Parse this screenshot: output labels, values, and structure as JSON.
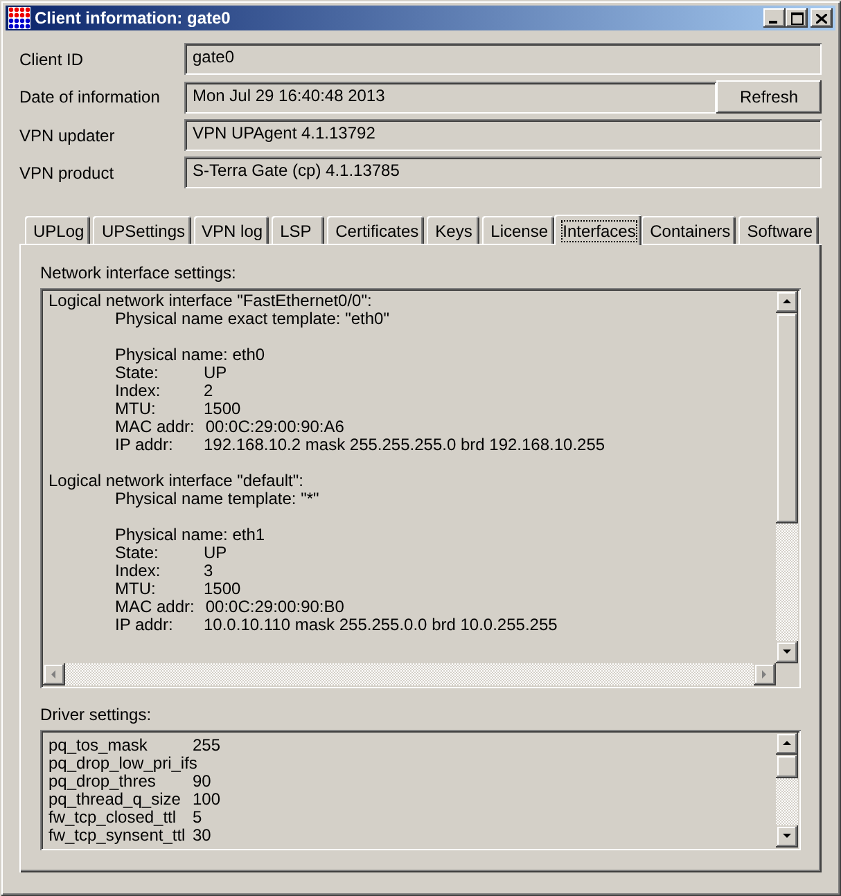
{
  "window": {
    "title": "Client information: gate0"
  },
  "info": [
    {
      "label": "Client ID",
      "value": "gate0"
    },
    {
      "label": "Date of information",
      "value": "Mon Jul 29 16:40:48 2013",
      "button": "Refresh"
    },
    {
      "label": "VPN updater",
      "value": "VPN UPAgent 4.1.13792"
    },
    {
      "label": "VPN product",
      "value": "S-Terra Gate (cp) 4.1.13785"
    }
  ],
  "tabs": [
    {
      "label": "UPLog",
      "selected": false
    },
    {
      "label": "UPSettings",
      "selected": false
    },
    {
      "label": "VPN log",
      "selected": false
    },
    {
      "label": "LSP",
      "selected": false
    },
    {
      "label": "Certificates",
      "selected": false
    },
    {
      "label": "Keys",
      "selected": false
    },
    {
      "label": "License",
      "selected": false
    },
    {
      "label": "Interfaces",
      "selected": true
    },
    {
      "label": "Containers",
      "selected": false
    },
    {
      "label": "Software",
      "selected": false
    }
  ],
  "network_settings": {
    "label": "Network interface settings:",
    "interfaces": [
      {
        "title": "Logical network interface \"FastEthernet0/0\":",
        "template": "Physical name exact template: \"eth0\"",
        "physical_name": "Physical name: eth0",
        "fields": [
          {
            "key": "State:",
            "value": "UP"
          },
          {
            "key": "Index:",
            "value": "2"
          },
          {
            "key": "MTU:",
            "value": "1500"
          },
          {
            "key": "MAC addr:",
            "value": "00:0C:29:00:90:A6"
          },
          {
            "key": "IP addr:",
            "value": "192.168.10.2 mask 255.255.255.0 brd 192.168.10.255"
          }
        ]
      },
      {
        "title": "Logical network interface \"default\":",
        "template": "Physical name template: \"*\"",
        "physical_name": "Physical name: eth1",
        "fields": [
          {
            "key": "State:",
            "value": "UP"
          },
          {
            "key": "Index:",
            "value": "3"
          },
          {
            "key": "MTU:",
            "value": "1500"
          },
          {
            "key": "MAC addr:",
            "value": "00:0C:29:00:90:B0"
          },
          {
            "key": "IP addr:",
            "value": "10.0.10.110 mask 255.255.0.0 brd 10.0.255.255"
          }
        ]
      }
    ]
  },
  "driver_settings": {
    "label": "Driver settings:",
    "rows": [
      {
        "name": "pq_tos_mask",
        "value": "255"
      },
      {
        "name": "pq_drop_low_pri_ifs"
      },
      {
        "name": "pq_drop_thres",
        "value": "90"
      },
      {
        "name": "pq_thread_q_size",
        "value": "100"
      },
      {
        "name": "fw_tcp_closed_ttl",
        "value": "5"
      },
      {
        "name": "fw_tcp_synsent_ttl",
        "value": "30"
      }
    ]
  }
}
